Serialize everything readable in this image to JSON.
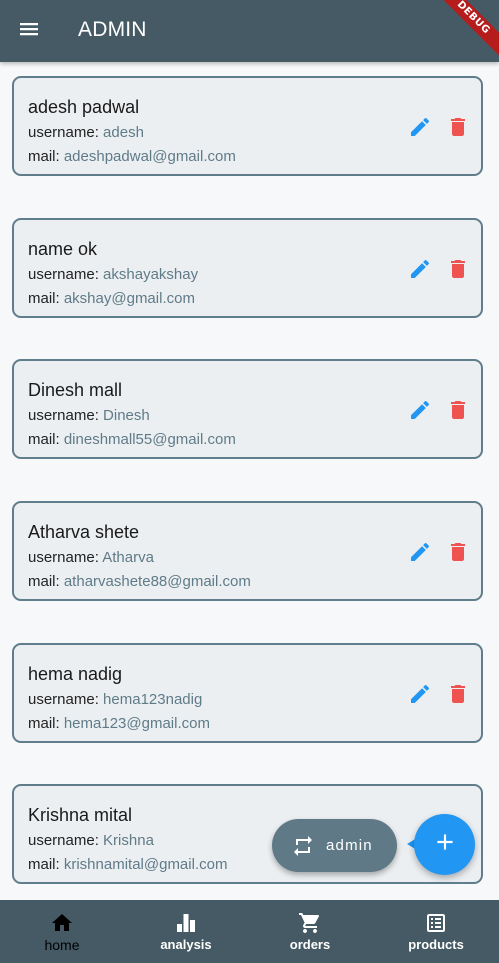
{
  "appbar": {
    "title": "ADMIN",
    "menu_icon": "menu-icon",
    "debug_banner": "DEBUG",
    "background": "#455a64"
  },
  "users": [
    {
      "name": "adesh padwal",
      "username_label": "username: ",
      "username": "adesh",
      "mail_label": "mail: ",
      "mail": "adeshpadwal@gmail.com"
    },
    {
      "name": "name ok",
      "username_label": "username: ",
      "username": "akshayakshay",
      "mail_label": "mail: ",
      "mail": "akshay@gmail.com"
    },
    {
      "name": "Dinesh mall",
      "username_label": "username: ",
      "username": "Dinesh",
      "mail_label": "mail: ",
      "mail": "dineshmall55@gmail.com"
    },
    {
      "name": "Atharva shete",
      "username_label": "username: ",
      "username": "Atharva",
      "mail_label": "mail: ",
      "mail": "atharvashete88@gmail.com"
    },
    {
      "name": "hema nadig",
      "username_label": "username: ",
      "username": "hema123nadig",
      "mail_label": "mail: ",
      "mail": "hema123@gmail.com"
    },
    {
      "name": "Krishna mital",
      "username_label": "username: ",
      "username": "Krishna",
      "mail_label": "mail: ",
      "mail": "krishnamital@gmail.com"
    }
  ],
  "card_actions": {
    "edit_icon": "edit-icon",
    "delete_icon": "delete-icon",
    "edit_color": "#2196f3",
    "delete_color": "#ef5350"
  },
  "fab_extended": {
    "label": "admin",
    "icon": "swap-icon"
  },
  "fab": {
    "icon": "add-icon",
    "color": "#2196f3"
  },
  "bottom_nav": {
    "items": [
      {
        "label": "home",
        "icon": "home-icon",
        "active": true
      },
      {
        "label": "analysis",
        "icon": "bar-chart-icon",
        "active": false
      },
      {
        "label": "orders",
        "icon": "cart-icon",
        "active": false
      },
      {
        "label": "products",
        "icon": "list-icon",
        "active": false
      }
    ]
  }
}
